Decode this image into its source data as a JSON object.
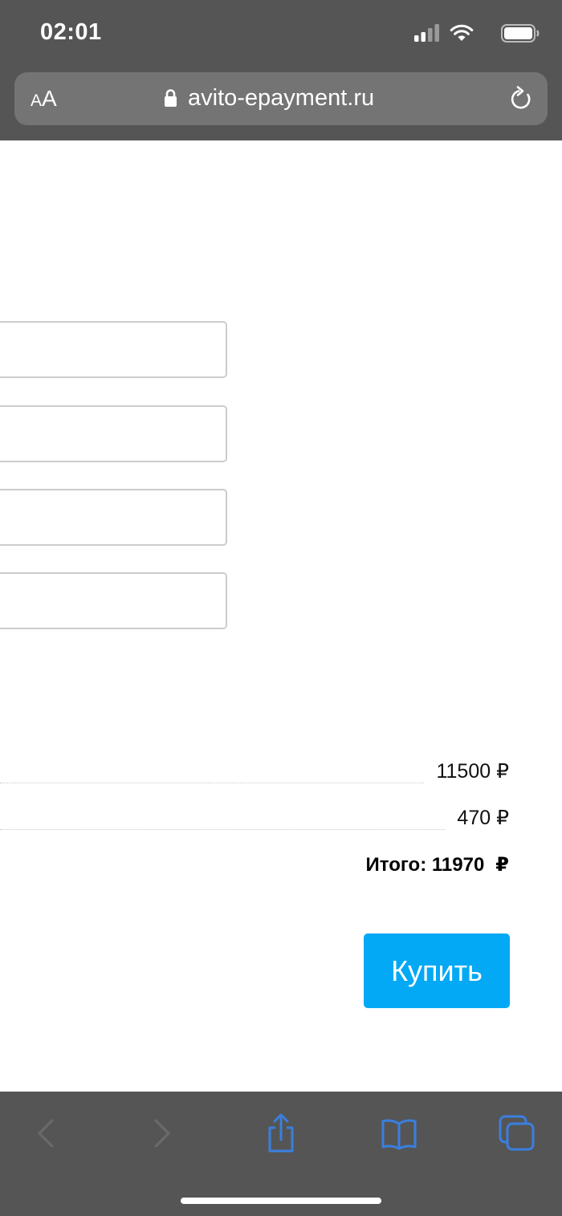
{
  "status_bar": {
    "time": "02:01",
    "icons": [
      "cellular-signal-icon",
      "wifi-icon",
      "battery-icon"
    ]
  },
  "browser": {
    "text_size_button": {
      "small": "A",
      "large": "A"
    },
    "url": "avito-epayment.ru",
    "icons": [
      "lock-icon",
      "reload-icon"
    ]
  },
  "form": {
    "fields": [
      {
        "value": "",
        "placeholder": ""
      },
      {
        "value": "",
        "placeholder": ""
      },
      {
        "value": "",
        "placeholder": ""
      },
      {
        "value": "",
        "placeholder": ""
      }
    ]
  },
  "order": {
    "lines": [
      {
        "amount": "11500 ₽"
      },
      {
        "amount": "470 ₽"
      }
    ],
    "total_label": "Итого: 11970",
    "total_currency": "₽"
  },
  "buy_button_label": "Купить",
  "toolbar": {
    "icons": [
      "back-icon",
      "forward-icon",
      "share-icon",
      "bookmarks-icon",
      "tabs-icon"
    ],
    "accent_color": "#3a7fdf",
    "disabled_color": "#6a6a6a"
  },
  "colors": {
    "chrome_bg": "#555555",
    "button_bg": "#03a9f4"
  }
}
